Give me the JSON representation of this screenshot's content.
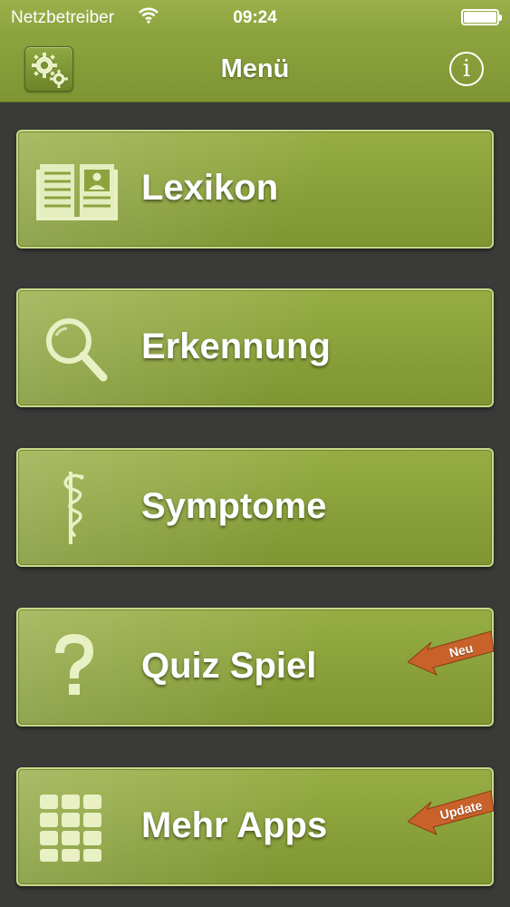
{
  "status_bar": {
    "carrier": "Netzbetreiber",
    "time": "09:24"
  },
  "nav": {
    "title": "Menü",
    "info_label": "i"
  },
  "menu": [
    {
      "label": "Lexikon",
      "icon": "open-book-icon"
    },
    {
      "label": "Erkennung",
      "icon": "magnifier-icon"
    },
    {
      "label": "Symptome",
      "icon": "caduceus-icon"
    },
    {
      "label": "Quiz Spiel",
      "icon": "question-mark-icon",
      "badge": "Neu"
    },
    {
      "label": "Mehr Apps",
      "icon": "apps-grid-icon",
      "badge": "Update"
    }
  ],
  "colors": {
    "bar": "#8ca33e",
    "button": "#8aa03b",
    "background": "#3a3a38",
    "icon": "#e8f0c4",
    "ribbon": "#c9612a"
  }
}
